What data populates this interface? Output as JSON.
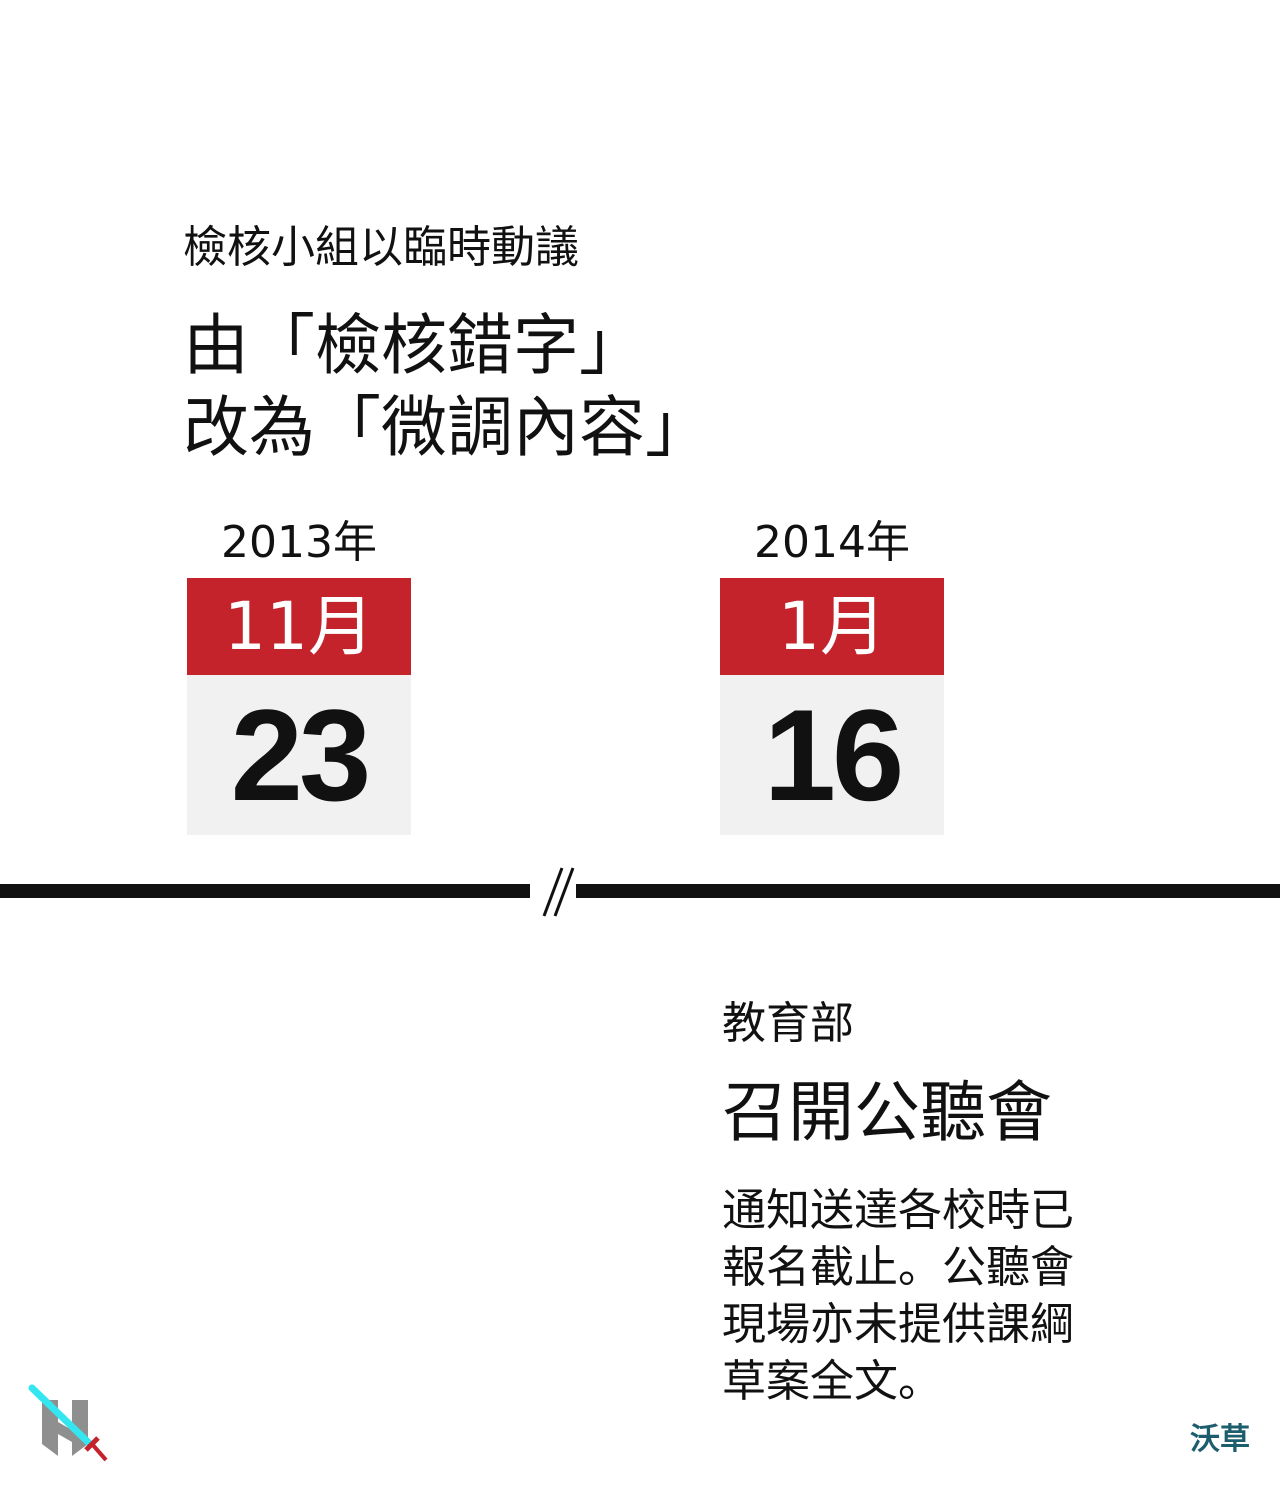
{
  "event1": {
    "subtitle": "檢核小組以臨時動議",
    "headline_line1": "由「檢核錯字」",
    "headline_line2": "改為「微調內容」"
  },
  "dates": [
    {
      "year": "2013年",
      "month": "11月",
      "day": "23"
    },
    {
      "year": "2014年",
      "month": "1月",
      "day": "16"
    }
  ],
  "event2": {
    "subtitle": "教育部",
    "headline": "召開公聽會",
    "description": "通知送達各校時已報名截止。公聽會現場亦未提供課綱草案全文。"
  },
  "credit": "沃草",
  "colors": {
    "calendar_header": "#c4232c",
    "calendar_body": "#f1f1f1",
    "text": "#111111",
    "credit": "#1d5e6e",
    "logo_sword": "#33e6f0",
    "logo_grey": "#8f8f8f"
  },
  "icons": {
    "logo": "sword-logo-icon",
    "break": "timeline-break-icon"
  }
}
